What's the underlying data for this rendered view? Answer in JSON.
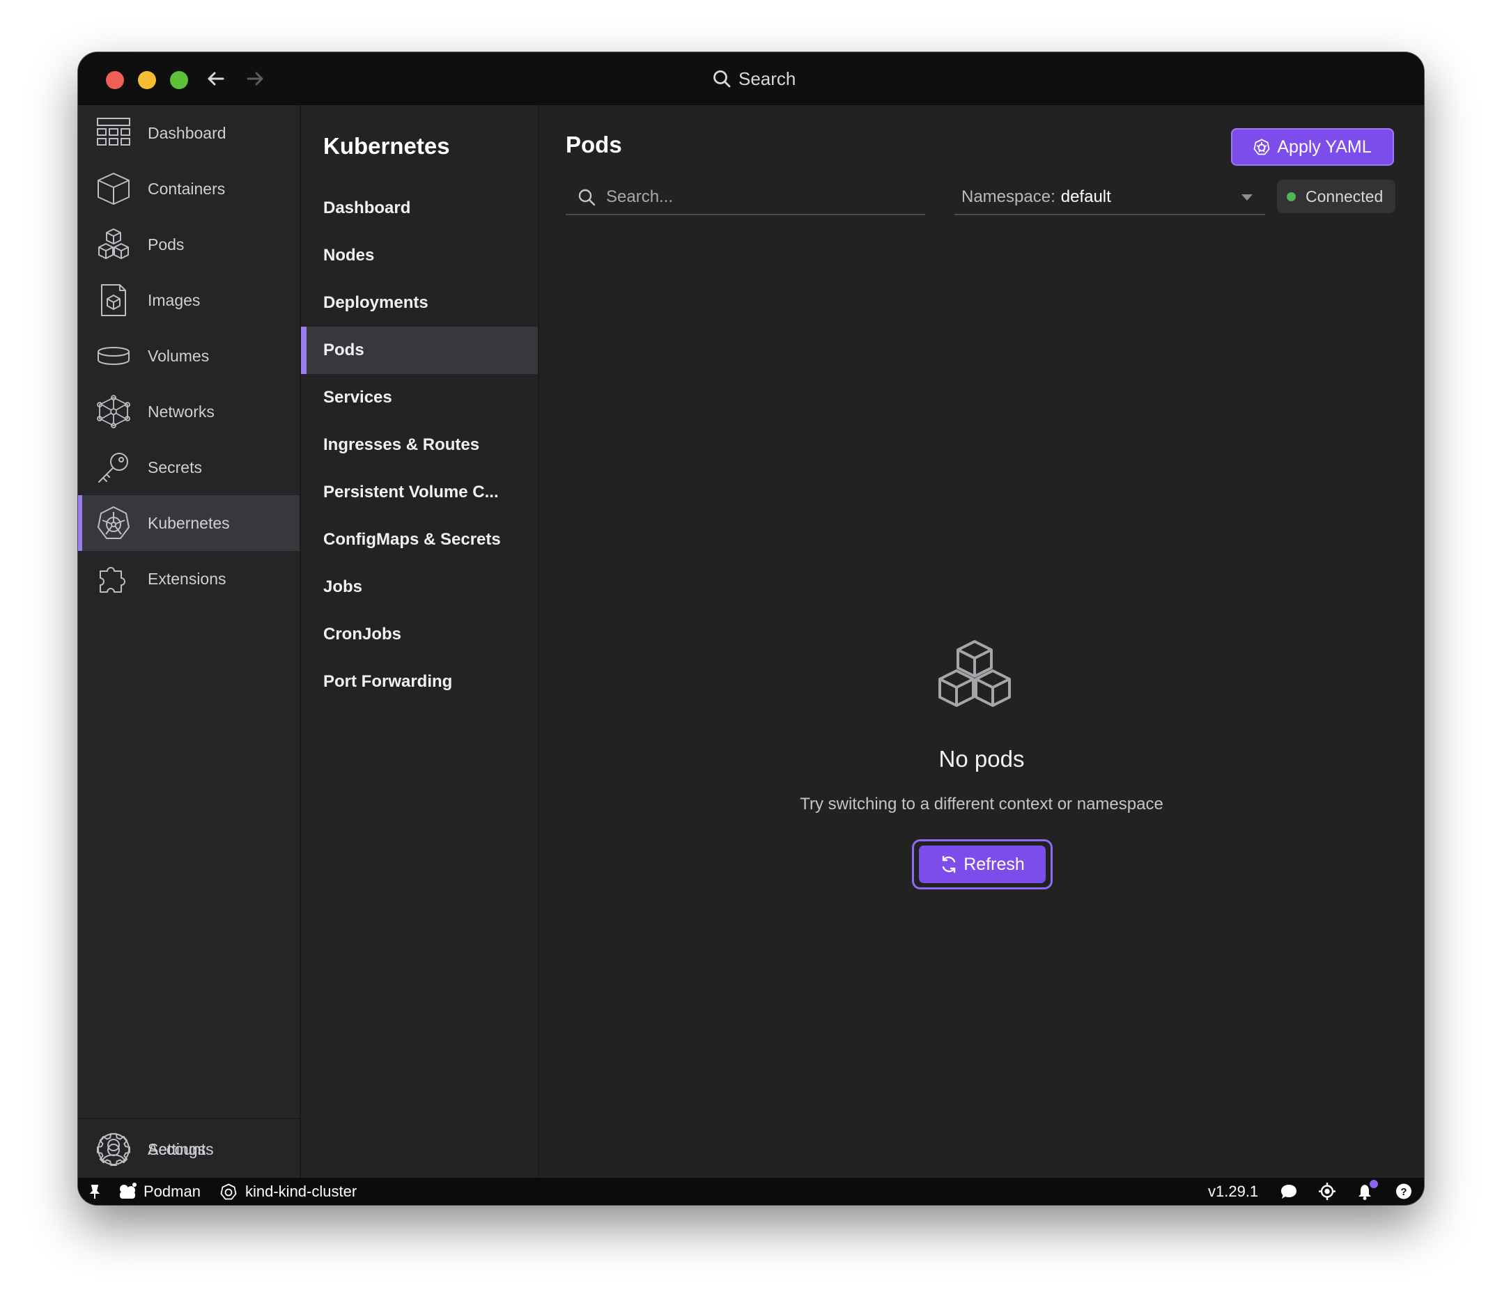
{
  "titlebar": {
    "search_label": "Search"
  },
  "sidebar": {
    "items": [
      {
        "label": "Dashboard",
        "icon": "dashboard-icon"
      },
      {
        "label": "Containers",
        "icon": "container-box-icon"
      },
      {
        "label": "Pods",
        "icon": "pods-cubes-icon"
      },
      {
        "label": "Images",
        "icon": "image-file-icon"
      },
      {
        "label": "Volumes",
        "icon": "volume-cylinder-icon"
      },
      {
        "label": "Networks",
        "icon": "network-icon"
      },
      {
        "label": "Secrets",
        "icon": "key-icon"
      },
      {
        "label": "Kubernetes",
        "icon": "kubernetes-icon",
        "active": true
      },
      {
        "label": "Extensions",
        "icon": "puzzle-icon"
      }
    ],
    "bottom": [
      {
        "label": "Accounts",
        "icon": "account-icon"
      },
      {
        "label": "Settings",
        "icon": "gear-icon"
      }
    ]
  },
  "subnav": {
    "title": "Kubernetes",
    "items": [
      {
        "label": "Dashboard"
      },
      {
        "label": "Nodes"
      },
      {
        "label": "Deployments"
      },
      {
        "label": "Pods",
        "active": true
      },
      {
        "label": "Services"
      },
      {
        "label": "Ingresses & Routes"
      },
      {
        "label": "Persistent Volume C..."
      },
      {
        "label": "ConfigMaps & Secrets"
      },
      {
        "label": "Jobs"
      },
      {
        "label": "CronJobs"
      },
      {
        "label": "Port Forwarding"
      }
    ]
  },
  "main": {
    "title": "Pods",
    "apply_label": "Apply YAML",
    "search_placeholder": "Search...",
    "namespace_label": "Namespace:",
    "namespace_value": "default",
    "connection_status": "Connected",
    "empty_title": "No pods",
    "empty_subtitle": "Try switching to a different context or namespace",
    "refresh_label": "Refresh"
  },
  "statusbar": {
    "engine": "Podman",
    "context": "kind-kind-cluster",
    "version": "v1.29.1"
  },
  "colors": {
    "accent": "#7c4dea",
    "active_indicator": "#9b7bf0",
    "connected": "#4fb653"
  }
}
